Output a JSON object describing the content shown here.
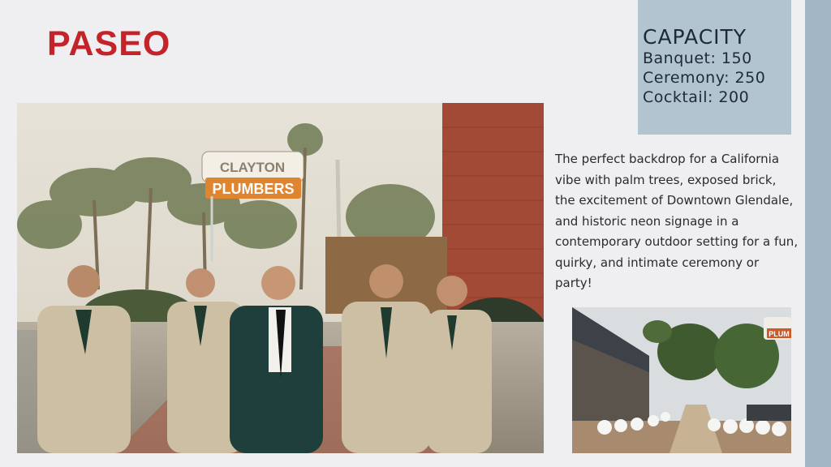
{
  "slide": {
    "title": "PASEO",
    "capacity": {
      "heading": "CAPACITY",
      "lines": [
        "Banquet: 150",
        "Ceremony: 250",
        "Cocktail: 200"
      ]
    },
    "description": "The perfect backdrop for a California vibe with palm trees, exposed brick, the excitement of Downtown Glendale, and historic neon signage in a contemporary outdoor setting for a fun, quirky, and intimate ceremony or party!",
    "main_photo": {
      "sign_top": "CLAYTON",
      "sign_bottom": "PLUMBERS"
    },
    "small_photo": {
      "sign_text": "PLUM"
    }
  },
  "colors": {
    "background": "#efeff1",
    "title": "#c5232a",
    "capacity_box": "#b3c4d1",
    "right_strip": "#a3b6c6"
  }
}
